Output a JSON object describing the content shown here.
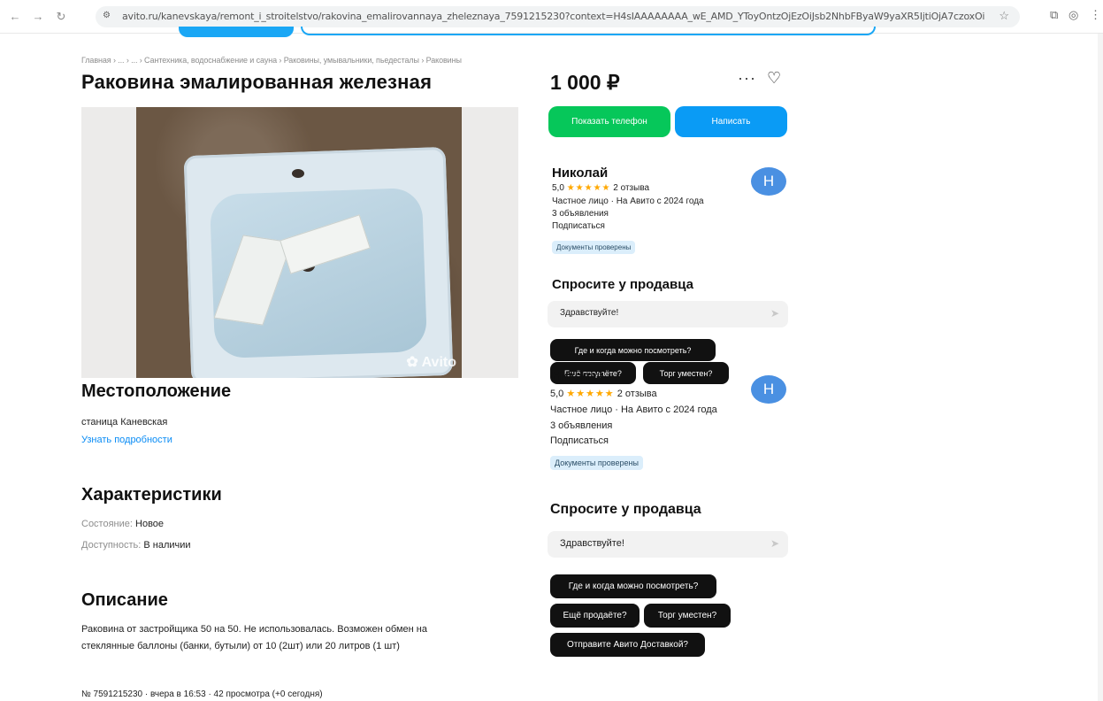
{
  "browser": {
    "url": "avito.ru/kanevskaya/remont_i_stroitelstvo/rakovina_emalirovannaya_zheleznaya_7591215230?context=H4sIAAAAAAAA_wE_AMD_YToyOntzOjEzOiJsb2NhbFByaW9yaXR5IjtiOjA7czoxOiI4IjtzOjE2..."
  },
  "breadcrumbs": "Главная › ... › ... › Сантехника, водоснабжение и сауна › Раковины, умывальники, пьедесталы › Раковины",
  "listing": {
    "title": "Раковина эмалированная железная",
    "price": "1 000 ₽",
    "photo_watermark": "Avito"
  },
  "actions": {
    "show_phone": "Показать телефон",
    "write": "Написать"
  },
  "seller": {
    "name": "Николай",
    "avatar_letter": "Н",
    "rating": "5,0",
    "stars": "★★★★★",
    "reviews": "2 отзыва",
    "type": "Частное лицо · На Авито с 2024 года",
    "ads": "3 объявления",
    "subscribe": "Подписаться",
    "verified": "Документы проверены"
  },
  "ask": {
    "title": "Спросите у продавца",
    "message": "Здравствуйте!",
    "chips": [
      "Где и когда можно посмотреть?",
      "Ещё продаёте?",
      "Торг уместен?",
      "Отправите Авито Доставкой?"
    ]
  },
  "location": {
    "title": "Местоположение",
    "place": "станица Каневская",
    "more": "Узнать подробности"
  },
  "characteristics": {
    "title": "Характеристики",
    "condition_label": "Состояние:",
    "condition_value": "Новое",
    "availability_label": "Доступность:",
    "availability_value": "В наличии"
  },
  "description": {
    "title": "Описание",
    "line1": "Раковина от застройщика 50 на 50. Не использовалась. Возможен обмен на",
    "line2": "стеклянные баллоны (банки, бутыли) от 10 (2шт) или 20 литров (1 шт)"
  },
  "footer": {
    "meta": "№ 7591215230 · вчера в 16:53 · 42 просмотра (+0 сегодня)"
  },
  "colors": {
    "green": "#06c75a",
    "blue": "#0a9bf5",
    "link": "#0a8cf5",
    "star": "#ffa800"
  }
}
